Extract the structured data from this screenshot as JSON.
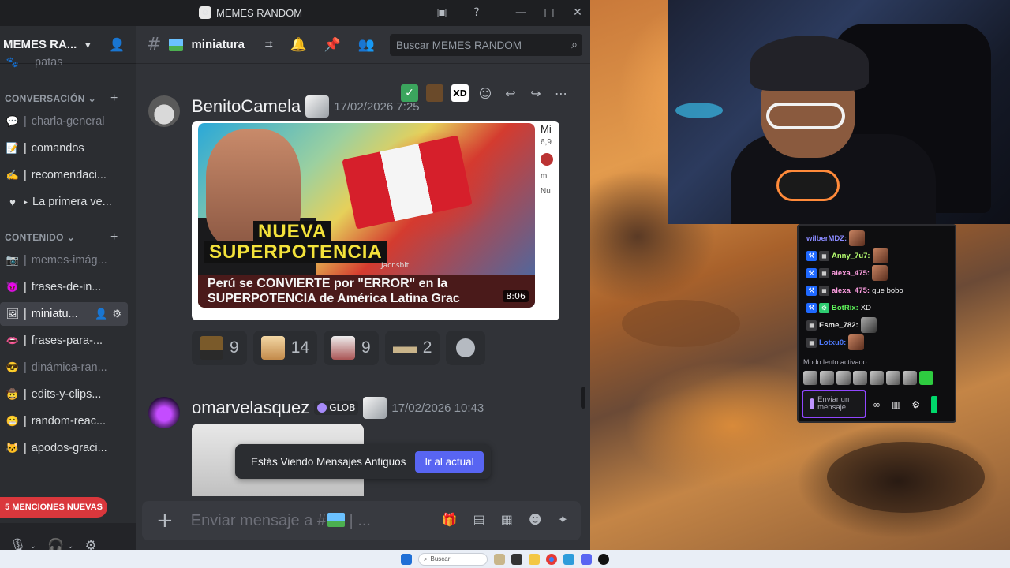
{
  "window": {
    "title": "MEMES RANDOM"
  },
  "server": {
    "name": "MEMES RA...",
    "truncated_channel": "patas"
  },
  "sidebar": {
    "categories": [
      {
        "label": "CONVERSACIÓN"
      },
      {
        "label": "CONTENIDO"
      }
    ],
    "channels_conv": [
      {
        "label": "charla-general",
        "muted": true,
        "icon": "speech-bubble"
      },
      {
        "label": "comandos",
        "muted": false,
        "icon": "notepad"
      },
      {
        "label": "recomendaci...",
        "muted": false,
        "icon": "writing-hand"
      },
      {
        "label": "La primera ve...",
        "muted": false,
        "icon": "heart-thread"
      }
    ],
    "channels_content": [
      {
        "label": "memes-imág...",
        "muted": true,
        "icon": "camera"
      },
      {
        "label": "frases-de-in...",
        "muted": false,
        "icon": "devil"
      },
      {
        "label": "miniatu...",
        "muted": false,
        "active": true,
        "icon": "picture"
      },
      {
        "label": "frases-para-...",
        "muted": false,
        "icon": "lips"
      },
      {
        "label": "dinámica-ran...",
        "muted": true,
        "icon": "sunglasses"
      },
      {
        "label": "edits-y-clips...",
        "muted": false,
        "icon": "cowboy"
      },
      {
        "label": "random-reac...",
        "muted": false,
        "icon": "grimace"
      },
      {
        "label": "apodos-graci...",
        "muted": false,
        "icon": "cat"
      }
    ],
    "mentions": "5 MENCIONES NUEVAS"
  },
  "header": {
    "channel": "miniatura",
    "search_placeholder": "Buscar MEMES RANDOM"
  },
  "messages": [
    {
      "author": "BenitoCamela",
      "time": "17/02/2026 7:25",
      "embed": {
        "title_line1": "NUEVA",
        "title_line2": "SUPERPOTENCIA",
        "subtitle": "Perú se CONVIERTE por \"ERROR\" en la SUPERPOTENCIA de América Latina Grac",
        "duration": "8:06",
        "watermark": "Jacnsbit",
        "side_labels": [
          "Mi",
          "6,9",
          "mi",
          "Nu"
        ]
      },
      "reactions": [
        {
          "count": "9",
          "emoji": "xd-minecraft"
        },
        {
          "count": "14",
          "emoji": "shocked-face"
        },
        {
          "count": "9",
          "emoji": "cat-face"
        },
        {
          "count": "2",
          "emoji": "dog-lying"
        }
      ],
      "hover_toolbar": {
        "xd_label": "XD",
        "check": "✓"
      }
    },
    {
      "author": "omarvelasquez",
      "tag": "GLOB",
      "time": "17/02/2026 10:43"
    }
  ],
  "old_messages": {
    "text": "Estás Viendo Mensajes Antiguos",
    "button": "Ir al actual"
  },
  "composer": {
    "placeholder": "Enviar mensaje a #",
    "ellipsis": "..."
  },
  "twitch_chat": {
    "lines": [
      {
        "user": "wilberMDZ:",
        "color": "#8a8aff",
        "msg": ""
      },
      {
        "user": "Anny_7u7:",
        "color": "#b7ff70",
        "msg": ""
      },
      {
        "user": "alexa_475:",
        "color": "#ff9fe2",
        "msg": ""
      },
      {
        "user": "alexa_475:",
        "color": "#ff9fe2",
        "msg": "que bobo"
      },
      {
        "user": "BotRix:",
        "color": "#5ef55a",
        "msg": "XD"
      },
      {
        "user": "Esme_782:",
        "color": "#e5e5e5",
        "msg": ""
      },
      {
        "user": "Lotxu0:",
        "color": "#4f7bff",
        "msg": ""
      }
    ],
    "slow_mode": "Modo lento activado",
    "input_placeholder": "Enviar un mensaje"
  },
  "taskbar": {
    "search": "Buscar"
  }
}
